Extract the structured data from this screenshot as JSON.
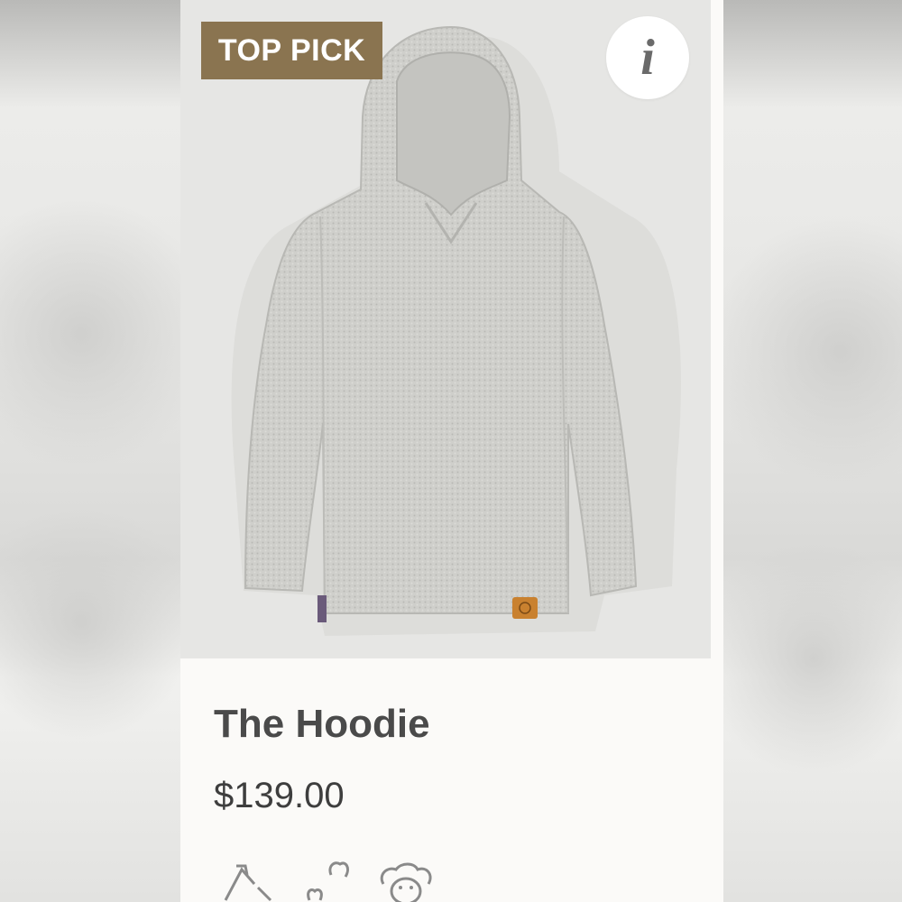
{
  "badge": {
    "label": "TOP PICK",
    "color": "#8a7450"
  },
  "info_button": {
    "icon": "info-icon",
    "glyph": "i"
  },
  "product": {
    "name": "The Hoodie",
    "price": "$139.00",
    "image": "grey-knit-hoodie"
  },
  "feature_icons": [
    "recycle-icon",
    "hoof-icon",
    "sheep-icon"
  ]
}
